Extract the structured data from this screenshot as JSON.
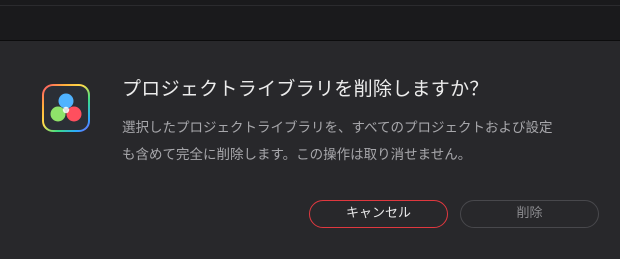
{
  "dialog": {
    "title": "プロジェクトライブラリを削除しますか？",
    "message": "選択したプロジェクトライブラリを、すべてのプロジェクトおよび設定も含めて完全に削除します。この操作は取り消せません。",
    "icon": "davinci-resolve-app-icon",
    "cancel_label": "キャンセル",
    "delete_label": "削除",
    "accent_color": "#e0383f"
  }
}
